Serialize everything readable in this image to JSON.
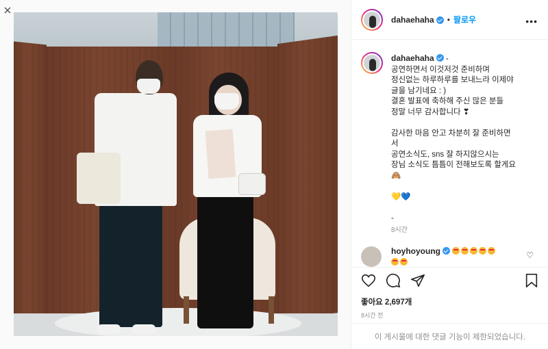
{
  "post": {
    "username": "dahaehaha",
    "follow_label": "팔로우",
    "more_label": "•••",
    "caption": {
      "author": "dahaehaha",
      "lead": "-",
      "lines": "공연하면서 이것저것 준비하며\n정신없는 하루하루를 보내느라 이제야\n글을 남기네요 : )\n결혼 발표에 축하해 주신 많은 분들\n정말 너무 감사합니다 ❣\n\n감사한 마음 안고 차분히 잘 준비하면\n서\n공연소식도, sns 잘 하지않으시는\n장님 소식도 틈틈이 전해보도록 할게요\n🙈\n\n💛💙\n\n-",
      "time": "8시간"
    },
    "comment": {
      "author": "hoyhoyoung",
      "emoji_count_row1": 5,
      "emoji_count_row2": 2
    },
    "likes_label": "좋아요 2,697개",
    "time_ago": "8시간 전",
    "comments_disabled": "이 게시물에 대한 댓글 기능이 제한되었습니다."
  },
  "icons": {
    "like": "heart-icon",
    "comment": "comment-icon",
    "share": "share-icon",
    "save": "bookmark-icon",
    "verified": "verified-badge-icon"
  },
  "colors": {
    "follow_blue": "#0095f6",
    "verified_blue": "#3897f0",
    "muted_text": "#8e8e8e"
  }
}
